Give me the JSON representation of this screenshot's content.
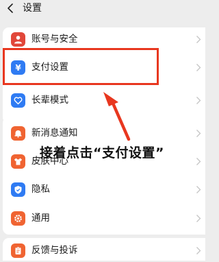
{
  "header": {
    "title": "设置"
  },
  "rows": [
    {
      "id": "account",
      "label": "账号与安全",
      "icon": "person-icon",
      "color": "#e1473a"
    },
    {
      "id": "payment",
      "label": "支付设置",
      "icon": "yuan-icon",
      "color": "#2f7bf3"
    },
    {
      "id": "elder",
      "label": "长辈模式",
      "icon": "heart-hands-icon",
      "color": "#2f7bf3"
    },
    {
      "id": "notify",
      "label": "新消息通知",
      "icon": "bell-icon",
      "color": "#f06432"
    },
    {
      "id": "skin",
      "label": "皮肤中心",
      "icon": "shirt-icon",
      "color": "#f06432"
    },
    {
      "id": "privacy",
      "label": "隐私",
      "icon": "shield-icon",
      "color": "#2f7bf3"
    },
    {
      "id": "general",
      "label": "通用",
      "icon": "gear-icon",
      "color": "#f06432"
    },
    {
      "id": "feedback",
      "label": "反馈与投诉",
      "icon": "clipboard-icon",
      "color": "#f06432"
    }
  ],
  "annotation": {
    "text": "接着点击“支付设置”",
    "color": "#e8371f"
  }
}
